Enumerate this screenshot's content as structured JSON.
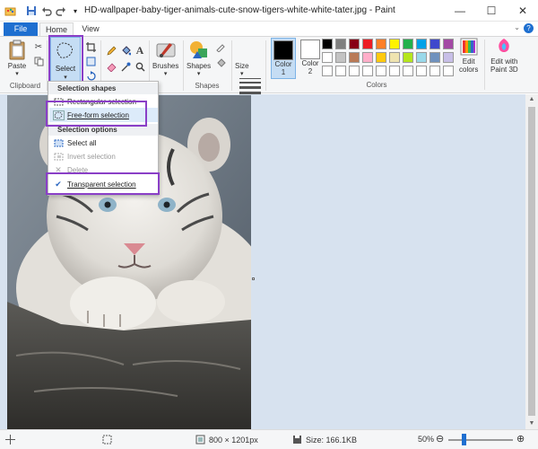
{
  "title_bar": {
    "title": "HD-wallpaper-baby-tiger-animals-cute-snow-tigers-white-white-tater.jpg - Paint",
    "controls": [
      "minimize",
      "maximize",
      "close"
    ]
  },
  "tabs": {
    "file": "File",
    "home": "Home",
    "view": "View"
  },
  "ribbon": {
    "clipboard": {
      "label": "Clipboard",
      "paste": "Paste"
    },
    "image": {
      "select": "Select"
    },
    "tools": {},
    "brushes": {
      "label": "Brushes"
    },
    "shapes": {
      "label": "Shapes",
      "button": "Shapes"
    },
    "size": {
      "label": "Size"
    },
    "colors": {
      "label": "Colors",
      "color1": "Color\n1",
      "color2": "Color\n2",
      "edit_colors": "Edit\ncolors",
      "paint3d": "Edit with\nPaint 3D",
      "palette": [
        "#000000",
        "#7f7f7f",
        "#880015",
        "#ed1c24",
        "#ff7f27",
        "#fff200",
        "#22b14c",
        "#00a2e8",
        "#3f48cc",
        "#a349a4",
        "#ffffff",
        "#c3c3c3",
        "#b97a57",
        "#ffaec9",
        "#ffc90e",
        "#efe4b0",
        "#b5e61d",
        "#99d9ea",
        "#7092be",
        "#c8bfe7",
        "#ffffff",
        "#ffffff",
        "#ffffff",
        "#ffffff",
        "#ffffff",
        "#ffffff",
        "#ffffff",
        "#ffffff",
        "#ffffff",
        "#ffffff"
      ]
    }
  },
  "select_menu": {
    "heading_shapes": "Selection shapes",
    "rectangular": "Rectangular selection",
    "freeform": "Free-form selection",
    "heading_options": "Selection options",
    "select_all": "Select all",
    "invert": "Invert selection",
    "delete": "Delete",
    "transparent": "Transparent selection"
  },
  "status_bar": {
    "dimensions": "800 × 1201px",
    "size": "Size: 166.1KB",
    "zoom": "50%"
  },
  "colors": {
    "accent": "#1e6fd0",
    "highlight_outline": "#8a3fc7",
    "workspace": "#d7e2ef"
  }
}
